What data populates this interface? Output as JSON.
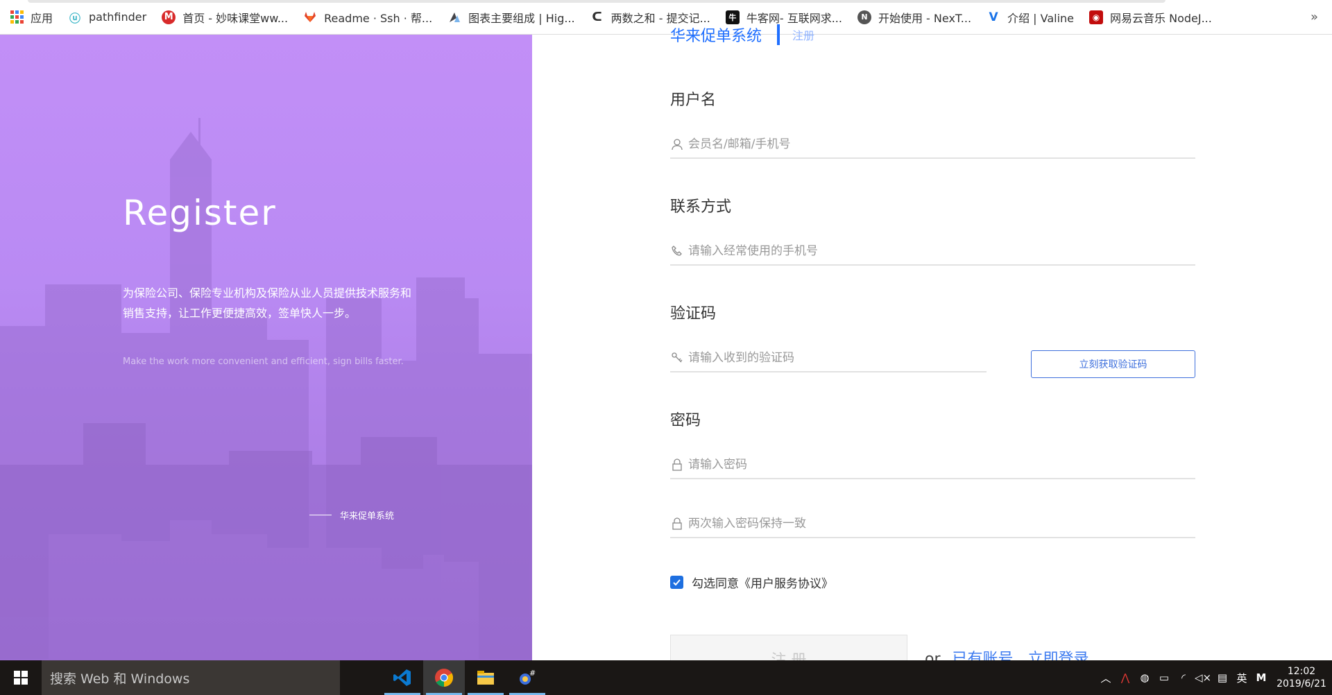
{
  "bookmarks": [
    {
      "label": "应用",
      "icon": "apps-grid-icon"
    },
    {
      "label": "pathfinder",
      "icon": "pathfinder-icon"
    },
    {
      "label": "首页 - 妙味课堂ww...",
      "icon": "miaov-icon"
    },
    {
      "label": "Readme · Ssh · 帮...",
      "icon": "gitlab-icon"
    },
    {
      "label": "图表主要组成 | Hig...",
      "icon": "highcharts-icon"
    },
    {
      "label": "两数之和 - 提交记...",
      "icon": "leetcode-icon"
    },
    {
      "label": "牛客网- 互联网求...",
      "icon": "nowcoder-icon"
    },
    {
      "label": "开始使用 - NexT...",
      "icon": "next-icon"
    },
    {
      "label": "介绍 | Valine",
      "icon": "valine-icon"
    },
    {
      "label": "网易云音乐 NodeJ...",
      "icon": "netease-music-icon"
    }
  ],
  "bookmarks_more": "»",
  "hero": {
    "title": "Register",
    "desc": "为保险公司、保险专业机构及保险从业人员提供技术服务和销售支持，让工作更便捷高效，签单快人一步。",
    "en": "Make the work more convenient and efficient, sign bills faster.",
    "brand": "华来促单系统"
  },
  "header": {
    "title": "华来促单系统",
    "subtitle": "注册"
  },
  "form": {
    "username_label": "用户名",
    "username_placeholder": "会员名/邮箱/手机号",
    "contact_label": "联系方式",
    "contact_placeholder": "请输入经常使用的手机号",
    "code_label": "验证码",
    "code_placeholder": "请输入收到的验证码",
    "code_button": "立刻获取验证码",
    "password_label": "密码",
    "password_placeholder": "请输入密码",
    "confirm_placeholder": "两次输入密码保持一致",
    "agree_text": "勾选同意《用户服务协议》",
    "agree_checked": true,
    "submit": "注 册",
    "or": "or",
    "has_account": "已有账号",
    "login": "立即登录"
  },
  "taskbar": {
    "search": "搜索 Web 和 Windows",
    "apps": [
      "vscode-icon",
      "chrome-icon",
      "file-explorer-icon",
      "csharp-tool-icon"
    ],
    "tray": {
      "ime": "英",
      "ime_mode": "M"
    },
    "time": "12:02",
    "date": "2019/6/21"
  },
  "colors": {
    "hero_purple": "#c28ff7",
    "accent_blue": "#3d6fdc",
    "checkbox_blue": "#1e6fe0"
  }
}
